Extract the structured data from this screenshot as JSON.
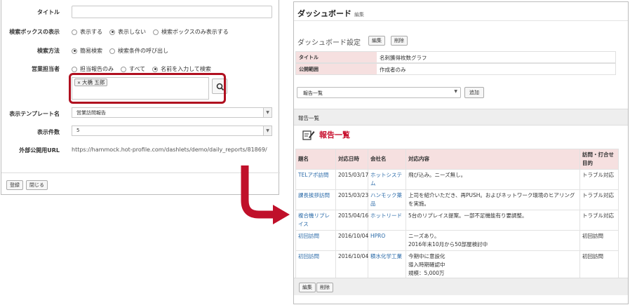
{
  "settings": {
    "title_label": "タイトル",
    "search_box_label": "検索ボックスの表示",
    "search_box_options": [
      "表示する",
      "表示しない",
      "検索ボックスのみ表示する"
    ],
    "search_method_label": "検索方法",
    "search_method_options": [
      "簡易検索",
      "検索条件の呼び出し"
    ],
    "sales_rep_label": "営業担当者",
    "sales_rep_options": [
      "担当報告のみ",
      "すべて",
      "名前を入力して検索"
    ],
    "sales_rep_tag": "大橋 五郎",
    "template_label": "表示テンプレート名",
    "template_value": "営業訪問報告",
    "count_label": "表示件数",
    "count_value": "5",
    "url_label": "外部公開用URL",
    "url_value": "https://hammock.hot-profile.com/dashlets/demo/daily_reports/81869/",
    "register_button": "登録",
    "close_button": "閉じる"
  },
  "dashboard": {
    "title": "ダッシュボード",
    "title_sub": "編集",
    "settings_title": "ダッシュボード設定",
    "edit_button": "編集",
    "delete_button": "削除",
    "info_rows": [
      {
        "key": "タイトル",
        "value": "名刺獲得枚数グラフ"
      },
      {
        "key": "公開範囲",
        "value": "作成者のみ"
      }
    ],
    "select_value": "報告一覧",
    "add_button": "追加",
    "list_bar_label": "報告一覧",
    "list_heading": "報告一覧",
    "columns": [
      "題名",
      "対応日時",
      "会社名",
      "対応内容",
      "訪問・打合せ目的"
    ],
    "rows": [
      {
        "title": "TELアポ訪問",
        "date": "2015/03/17",
        "company": "ホットシステム",
        "content": "飛び込み。ニーズ無し。",
        "purpose": "トラブル対応"
      },
      {
        "title": "課長挨拶訪問",
        "date": "2015/03/23",
        "company": "ハンモック薬品",
        "content": "上司を紹介いただき、再PUSH。およびネットワーク環境のヒアリングを実施。",
        "purpose": "トラブル対応"
      },
      {
        "title": "複合機リプレイス",
        "date": "2015/04/16",
        "company": "ホットリード",
        "content": "5台のリプレイス提案。一部不足機能有り要調整。",
        "purpose": "トラブル対応"
      },
      {
        "title": "初回訪問",
        "date": "2016/10/04",
        "company": "HPRO",
        "content": "ニーズあり。\n2016年末10月から50部屋検討中",
        "purpose": "初回訪問"
      },
      {
        "title": "初回訪問",
        "date": "2016/10/04",
        "company": "積水化学工業",
        "content": "今期中に意設化\n導入時期確認中\n規模：5,000万",
        "purpose": "初回訪問"
      }
    ],
    "footer_edit": "編集",
    "footer_delete": "削除"
  },
  "colors": {
    "highlight": "#b01020",
    "arrow": "#c0102a",
    "link": "#2a6aa8",
    "header_bg": "#f6e0e0"
  }
}
